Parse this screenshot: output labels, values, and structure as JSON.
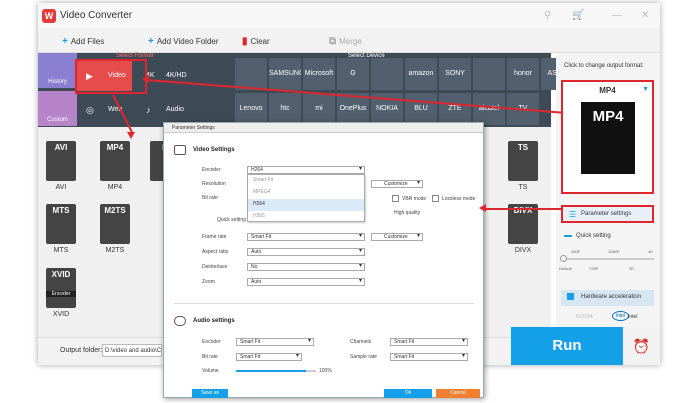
{
  "app": {
    "title": "Video Converter",
    "logo": "W",
    "window_icons": [
      "⚲",
      "🛒",
      "—",
      "✕"
    ]
  },
  "toolbar": {
    "add_files": "Add Files",
    "add_folder": "Add Video Folder",
    "clear": "Clear",
    "merge": "Merge"
  },
  "categories": {
    "select_format": "Select Format",
    "select_device": "Select Device",
    "history": "History",
    "custom": "Custom",
    "formats": [
      {
        "label": "Video",
        "icon": "▶"
      },
      {
        "label": "4K/HD",
        "icon": "4K"
      },
      {
        "label": "Web",
        "icon": "◎"
      },
      {
        "label": "Audio",
        "icon": "♪"
      }
    ],
    "brands_row1": [
      "",
      "SAMSUNG",
      "Microsoft",
      "G",
      "",
      "amazon",
      "SONY",
      "",
      "honor",
      "ASUS",
      ""
    ],
    "brands_row2": [
      "Lenovo",
      "htc",
      "mi",
      "OnePlus",
      "NOKIA",
      "BLU",
      "ZTE",
      "alcatel",
      "TV"
    ]
  },
  "grid": {
    "row1": [
      "AVI",
      "MP4",
      "N",
      "",
      "",
      "",
      "",
      "",
      "",
      "",
      "",
      "TS"
    ],
    "row2": [
      "MTS",
      "M2TS",
      "",
      "",
      "",
      "",
      "",
      "",
      "",
      "",
      "",
      "DIVX"
    ],
    "row3": [
      "XVID"
    ],
    "encoder_tag": "Encoder"
  },
  "output": {
    "label": "Output folder:",
    "path": "D:\\video and audio\\C"
  },
  "run": "Run",
  "right": {
    "hint": "Click to change output format:",
    "format": "MP4",
    "param_settings": "Parameter settings",
    "quick_setting": "Quick setting",
    "ticks_top": [
      "480P",
      "1080P",
      "4K"
    ],
    "ticks_bottom": [
      "Default",
      "720P",
      "2K"
    ],
    "hw_accel": "Hardware acceleration",
    "nvidia": "NVIDIA",
    "intel": "Intel"
  },
  "dialog": {
    "title": "Parameter Settings",
    "video_settings": "Video Settings",
    "audio_settings": "Audio settings",
    "encoder": "Encoder",
    "encoder_value": "H264",
    "encoder_options": [
      "Smart Fit",
      "MPEG4",
      "H264",
      "H265"
    ],
    "resolution": "Resolution",
    "bitrate": "Bit rate",
    "quick_setting": "Quick setting",
    "vbr_mode": "VBR mode",
    "lossless": "Lossless mode",
    "high_quality": "High quality",
    "customize": "Customize",
    "frame_rate": "Frame rate",
    "frame_rate_value": "Smart Fit",
    "aspect_ratio": "Aspect ratio",
    "aspect_value": "Auto",
    "deinterlace": "Deinterlace",
    "deinterlace_value": "No",
    "zoom": "Zoom",
    "zoom_value": "Auto",
    "a_encoder": "Encoder",
    "a_encoder_value": "Smart Fit",
    "channels": "Channels",
    "channels_value": "Smart Fit",
    "a_bitrate": "Bit rate",
    "a_bitrate_value": "Smart Fit",
    "sample_rate": "Sample rate",
    "sample_rate_value": "Smart Fit",
    "volume": "Volume",
    "volume_value": "100%",
    "save_as": "Save as",
    "ok": "Ok",
    "cancel": "Cancel"
  },
  "colors": {
    "accent": "#14a0e8",
    "highlight": "#e0262d",
    "dark": "#3f4a57"
  }
}
